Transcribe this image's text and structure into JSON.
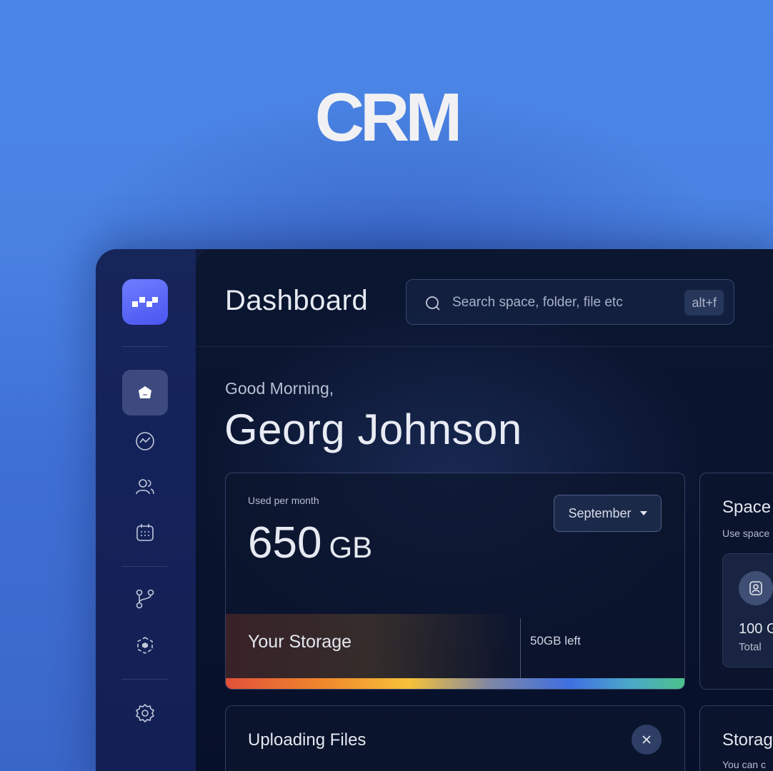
{
  "hero": {
    "title": "CRM"
  },
  "header": {
    "title": "Dashboard",
    "search": {
      "placeholder": "Search space, folder, file etc",
      "shortcut": "alt+f"
    }
  },
  "greeting": {
    "line": "Good Morning,",
    "name": "Georg Johnson"
  },
  "sidebar": {
    "items": [
      {
        "icon": "home-icon",
        "active": true
      },
      {
        "icon": "analytics-icon",
        "active": false
      },
      {
        "icon": "users-icon",
        "active": false
      },
      {
        "icon": "calendar-icon",
        "active": false
      },
      {
        "icon": "branch-icon",
        "active": false
      },
      {
        "icon": "cube-icon",
        "active": false
      },
      {
        "icon": "gear-icon",
        "active": false
      }
    ]
  },
  "storage_card": {
    "used_label": "Used per month",
    "used_value": "650",
    "used_unit": "GB",
    "month": "September",
    "storage_label": "Your Storage",
    "left_label": "50GB left"
  },
  "space_card": {
    "title": "Space",
    "subtitle": "Use space",
    "value": "100 G",
    "total_label": "Total"
  },
  "upload_card": {
    "title": "Uploading Files"
  },
  "storage2_card": {
    "title": "Storag",
    "subtitle": "You can c"
  },
  "colors": {
    "accent": "#5a66f5",
    "background_top": "#4a86e6",
    "panel": "#07102a",
    "rainbow": [
      "#e0503a",
      "#f08a2c",
      "#f5c13a",
      "#3f6fe0",
      "#4cc28a"
    ]
  }
}
